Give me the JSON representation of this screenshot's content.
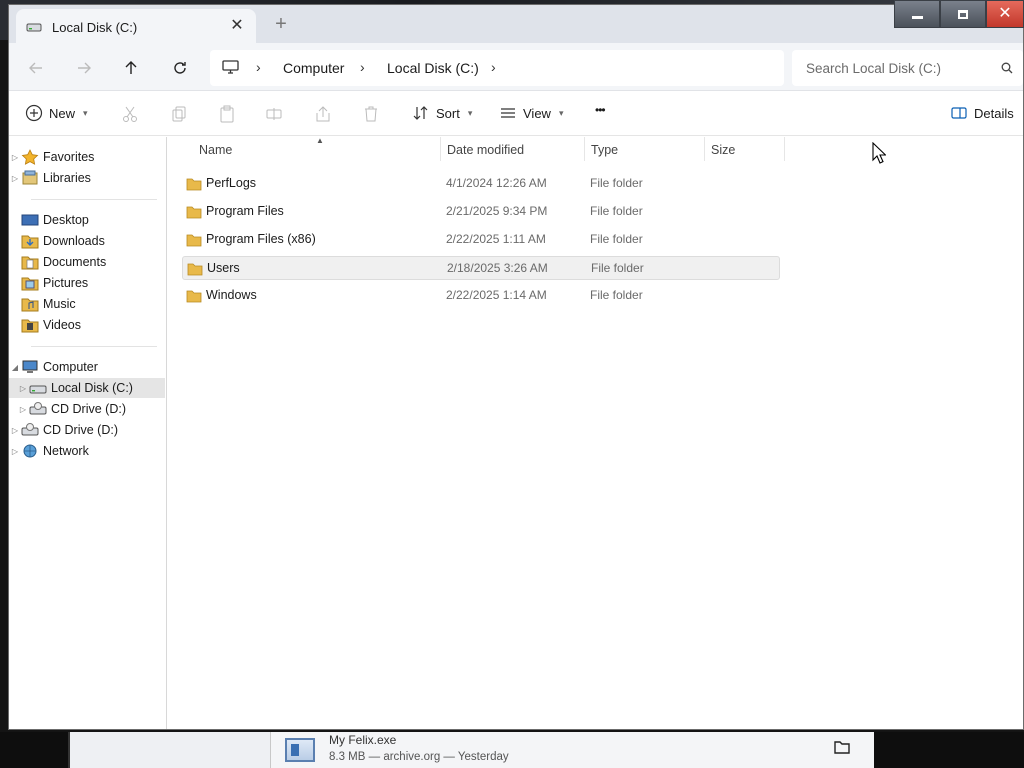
{
  "tab": {
    "title": "Local Disk (C:)",
    "close_label": "✕",
    "new_tab_label": "+"
  },
  "nav": {
    "breadcrumb": [
      "Computer",
      "Local Disk (C:)"
    ],
    "search_placeholder": "Search Local Disk (C:)"
  },
  "toolbar": {
    "new_label": "New",
    "sort_label": "Sort",
    "view_label": "View",
    "more_label": "•••",
    "details_label": "Details"
  },
  "sidebar": {
    "favorites": "Favorites",
    "libraries": "Libraries",
    "desktop": "Desktop",
    "downloads": "Downloads",
    "documents": "Documents",
    "pictures": "Pictures",
    "music": "Music",
    "videos": "Videos",
    "computer": "Computer",
    "local_disk": "Local Disk (C:)",
    "cd_drive_child": "CD Drive (D:)",
    "cd_drive": "CD Drive (D:)",
    "network": "Network"
  },
  "columns": {
    "name": "Name",
    "date": "Date modified",
    "type": "Type",
    "size": "Size"
  },
  "files": [
    {
      "name": "PerfLogs",
      "date": "4/1/2024 12:26 AM",
      "type": "File folder"
    },
    {
      "name": "Program Files",
      "date": "2/21/2025 9:34 PM",
      "type": "File folder"
    },
    {
      "name": "Program Files (x86)",
      "date": "2/22/2025 1:11 AM",
      "type": "File folder"
    },
    {
      "name": "Users",
      "date": "2/18/2025 3:26 AM",
      "type": "File folder"
    },
    {
      "name": "Windows",
      "date": "2/22/2025 1:14 AM",
      "type": "File folder"
    }
  ],
  "download": {
    "title": "My Felix.exe",
    "meta": "8.3 MB — archive.org — Yesterday"
  },
  "colors": {
    "folder": "#e8b94a",
    "selection": "#e5e5e5",
    "accent": "#0067c0"
  }
}
